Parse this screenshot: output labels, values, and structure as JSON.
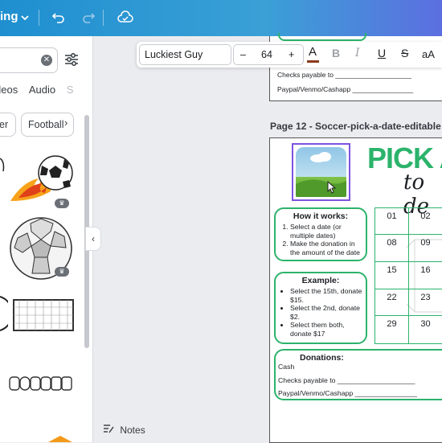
{
  "topbar": {
    "mode_label": "ing",
    "colors": {
      "start": "#1f8fd0",
      "end": "#5c6fe0"
    },
    "icons": [
      "chevron-down-icon",
      "undo-icon",
      "redo-icon",
      "cloud-check-icon"
    ]
  },
  "sidepanel": {
    "search_clear": "✕",
    "tabs": [
      "deos",
      "Audio",
      "S"
    ],
    "chips": [
      "er",
      "Football"
    ],
    "crown": "♛"
  },
  "toolbar": {
    "font_name": "Luckiest Guy",
    "size_minus": "–",
    "font_size": "64",
    "size_plus": "+",
    "text_color_label": "A",
    "text_color": "#8b3a1a",
    "bold": "B",
    "italic": "I",
    "underline": "U",
    "strikethrough": "S",
    "case": "aA"
  },
  "prev_page": {
    "line1": "Checks payable to ____________________",
    "line2": "Paypal/Venmo/Cashapp ________________"
  },
  "page": {
    "title": "Page 12 - Soccer-pick-a-date-editable",
    "headline": "PICK A",
    "subheadline": "to de",
    "how_title": "How it works:",
    "how_items": [
      "Select a date (or multiple dates)",
      "Make the donation in the amount of the date"
    ],
    "example_title": "Example:",
    "example_items": [
      "Select the 15th, donate $15.",
      "Select the 2nd, donate $2.",
      "Select them both, donate $17"
    ],
    "donations_title": "Donations:",
    "donation_cash": "Cash",
    "donation_checks": "Checks payable to ____________________",
    "donation_paypal": "Paypal/Venmo/Cashapp ________________",
    "dates": [
      "01",
      "02",
      "08",
      "09",
      "15",
      "16",
      "22",
      "23",
      "29",
      "30"
    ]
  },
  "notes": {
    "label": "Notes"
  },
  "collapse": {
    "label": "‹"
  }
}
